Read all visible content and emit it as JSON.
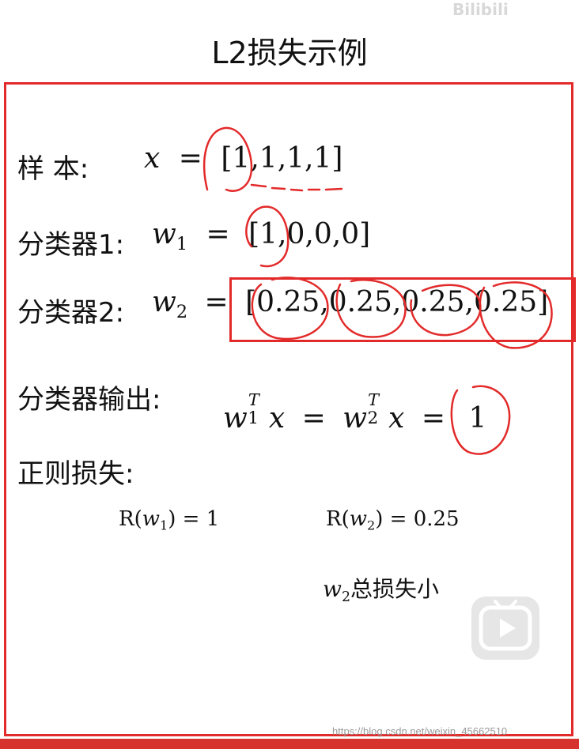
{
  "header": {
    "title": "L2损失示例",
    "top_logo_text": "Bilibili"
  },
  "rows": {
    "sample": {
      "label": "样  本:",
      "var": "x",
      "eq": "=",
      "vector": "[1,1,1,1]"
    },
    "clf1": {
      "label": "分类器1:",
      "var": "w",
      "sub": "1",
      "eq": "=",
      "vector": "[1,0,0,0]"
    },
    "clf2": {
      "label": "分类器2:",
      "var": "w",
      "sub": "2",
      "eq": "=",
      "vector": "[0.25,0.25,0.25,0.25]"
    },
    "output": {
      "label": "分类器输出:",
      "w": "w",
      "sub1": "1",
      "sub2": "2",
      "sup": "T",
      "x": "x",
      "eq": "=",
      "result": "1"
    },
    "reg": {
      "label": "正则损失:"
    }
  },
  "reg_values": {
    "r1_prefix": "R(",
    "r1_var": "w",
    "r1_sub": "1",
    "r1_suffix": ")  = 1",
    "r2_prefix": "R(",
    "r2_var": "w",
    "r2_sub": "2",
    "r2_suffix": ") = 0.25"
  },
  "conclusion": {
    "var": "w",
    "sub": "2",
    "text": "总损失小"
  },
  "footer": {
    "watermark": "https://blog.csdn.net/weixin_45662510"
  },
  "colors": {
    "annotation": "#e32a2a",
    "bar": "#d6322e"
  },
  "icons": {
    "play": "play-icon"
  }
}
